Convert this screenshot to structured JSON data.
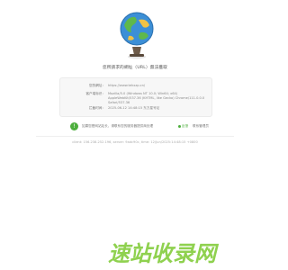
{
  "message": "您所請求的網址（URL）無法獲取",
  "info": {
    "url_label": "您的網址：",
    "url_value": "https://www.tekxzp.cn/",
    "ua_label": "客户端标识：",
    "ua_value": "Mozilla/5.0 (Windows NT 10.0; Win64; x64) AppleWebKit/537.36 (KHTML, like Gecko) Chrome/111.0.0.0 Safari/537.36",
    "time_label": "拦截时间：",
    "time_value": "2025-06-12 14:48:15 东方星号站"
  },
  "notice": {
    "text": "如果您是网站站长，请联系您的服务器提供商处理",
    "button_label": "反馈",
    "link_label": "联系管理员"
  },
  "footer": "client: 156.238.252.196, server: 9adc90c, time: 12/Jun/2025:14:48:15 +0800",
  "logo_text": "速站收录网",
  "colors": {
    "accent": "#4cae3c",
    "logo": "#8fd14f"
  }
}
